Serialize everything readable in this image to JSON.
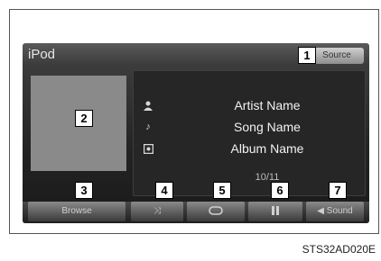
{
  "screen": {
    "title": "iPod",
    "source_label": "Source"
  },
  "now_playing": {
    "artist": "Artist Name",
    "song": "Song Name",
    "album": "Album Name",
    "track_position": "10/11",
    "artist_icon": "person-icon",
    "song_icon": "music-note-icon",
    "album_icon": "album-icon"
  },
  "controls": {
    "browse_label": "Browse",
    "shuffle_icon": "shuffle-icon",
    "repeat_icon": "repeat-icon",
    "pause_icon": "pause-icon",
    "sound_label": "Sound"
  },
  "callouts": [
    "1",
    "2",
    "3",
    "4",
    "5",
    "6",
    "7"
  ],
  "figure_id": "STS32AD020E",
  "colors": {
    "screen_bg": "#232323",
    "button_face": "#8a8a8a",
    "art_placeholder": "#8a8a8a",
    "text": "#f2f2f2"
  }
}
